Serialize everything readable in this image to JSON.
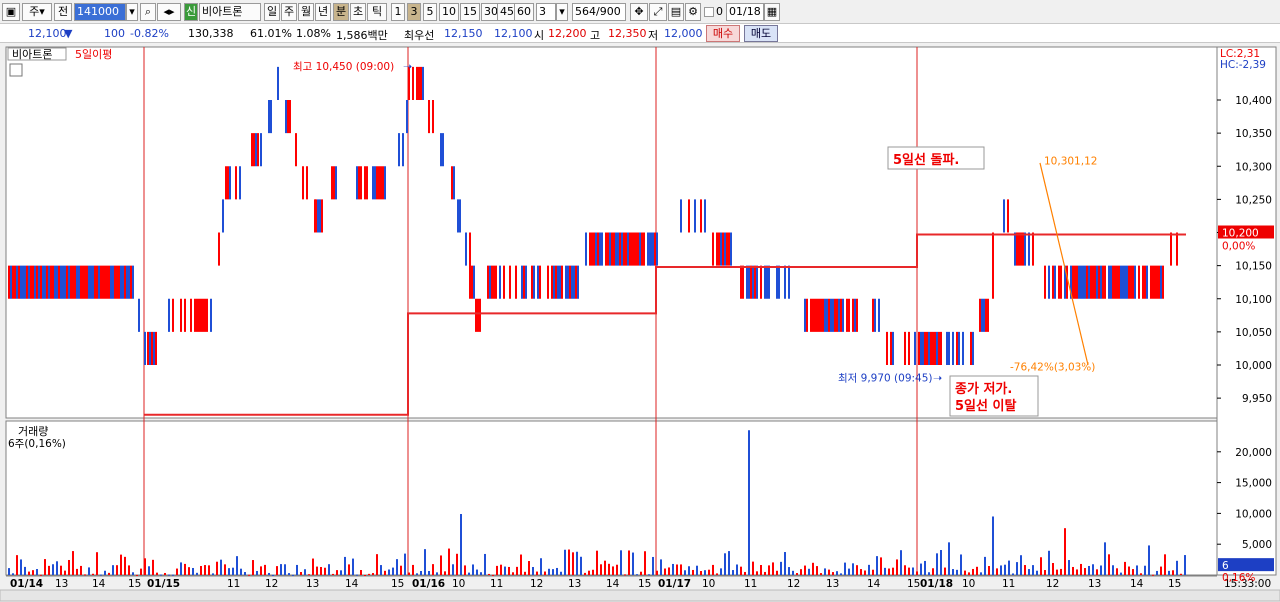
{
  "toolbar": {
    "type_label": "주",
    "jeon_label": "전",
    "code_value": "141000",
    "stock_name": "비아트론",
    "period_tabs": [
      "일",
      "주",
      "월",
      "년",
      "분",
      "초",
      "틱"
    ],
    "selected_period": "분",
    "interval_buttons": [
      "1",
      "3",
      "5",
      "10",
      "15",
      "30",
      "45",
      "60"
    ],
    "selected_interval": "3",
    "interval_select": "3",
    "count_display": "564/900",
    "checkbox_label": "0",
    "date_value": "01/18"
  },
  "infobar": {
    "price": "12,100",
    "change": "100",
    "change_pct": "-0.82%",
    "volume": "130,338",
    "vol_ratio": "61.01%",
    "turnover": "1.08%",
    "amount": "1,586백만",
    "hoga_label": "최우선",
    "ask1": "12,150",
    "bid1": "12,100",
    "open_label": "시",
    "open": "12,200",
    "high_label": "고",
    "high": "12,350",
    "low_label": "저",
    "low": "12,000",
    "buy_label": "매수",
    "sell_label": "매도"
  },
  "chart_data": {
    "type": "line",
    "title": "비아트론",
    "indicator": "5일이평",
    "volume_title": "거래량",
    "volume_sub": "6주(0,16%)",
    "price_axis": [
      "10,400",
      "10,350",
      "10,300",
      "10,250",
      "10,200",
      "10,150",
      "10,100",
      "10,050",
      "10,000",
      "9,950"
    ],
    "price_ylim": [
      9920,
      10480
    ],
    "volume_axis": [
      "20,000",
      "15,000",
      "10,000",
      "5,000"
    ],
    "volume_ylim": [
      0,
      25000
    ],
    "lc_label": "LC:2,31",
    "hc_label": "HC:-2,39",
    "current_price_label": "10,200",
    "current_pct_label": "0,00%",
    "current_volume_label": "6",
    "current_volume_pct": "0,16%",
    "time_label": "15:33:00",
    "x_labels": [
      {
        "t": "01/14",
        "day": true
      },
      {
        "t": "13"
      },
      {
        "t": "14"
      },
      {
        "t": "15"
      },
      {
        "t": "01/15",
        "day": true
      },
      {
        "t": "11"
      },
      {
        "t": "12"
      },
      {
        "t": "13"
      },
      {
        "t": "14"
      },
      {
        "t": "15"
      },
      {
        "t": "01/16",
        "day": true
      },
      {
        "t": "10"
      },
      {
        "t": "11"
      },
      {
        "t": "12"
      },
      {
        "t": "13"
      },
      {
        "t": "14"
      },
      {
        "t": "15"
      },
      {
        "t": "01/17",
        "day": true
      },
      {
        "t": "10"
      },
      {
        "t": "11"
      },
      {
        "t": "12"
      },
      {
        "t": "13"
      },
      {
        "t": "14"
      },
      {
        "t": "15"
      },
      {
        "t": "01/18",
        "day": true
      },
      {
        "t": "10"
      },
      {
        "t": "11"
      },
      {
        "t": "12"
      },
      {
        "t": "13"
      },
      {
        "t": "14"
      },
      {
        "t": "15"
      }
    ],
    "ma5_levels": [
      {
        "from": "01/15",
        "to": "01/16",
        "value": 9925
      },
      {
        "from": "01/16",
        "to": "01/17",
        "value": 10078
      },
      {
        "from": "01/17",
        "to": "01/18",
        "value": 10148
      },
      {
        "from": "01/18",
        "to": "close",
        "value": 10197
      }
    ],
    "annotations": {
      "high": "최고 10,450 (09:00)",
      "low": "최저 9,970 (09:45)",
      "note1": "5일선 돌파.",
      "note2_line1": "종가 저가.",
      "note2_line2": "5일선 이탈",
      "fib_top": "10,301,12",
      "fib_bottom": "-76,42%(3,03%)"
    },
    "colors": {
      "up": "#ff0000",
      "down": "#1f4fd6",
      "ma": "#e8282a",
      "fib": "#ff8000",
      "axis_text": "#000000"
    }
  }
}
